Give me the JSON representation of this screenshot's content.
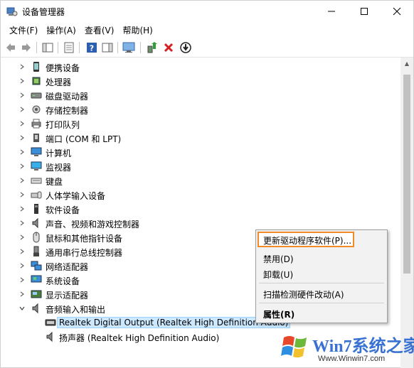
{
  "window": {
    "title": "设备管理器"
  },
  "menubar": {
    "items": [
      "文件(F)",
      "操作(A)",
      "查看(V)",
      "帮助(H)"
    ]
  },
  "toolbar": {
    "icons": [
      "back-arrow-icon",
      "forward-arrow-icon",
      "show-hide-tree-icon",
      "properties-icon",
      "help-icon",
      "action-pane-icon",
      "monitor-scan-icon",
      "update-driver-icon",
      "uninstall-x-icon",
      "download-driver-icon"
    ]
  },
  "tree": {
    "items": [
      {
        "label": "便携设备",
        "expanded": false,
        "icon": "portable-device-icon"
      },
      {
        "label": "处理器",
        "expanded": false,
        "icon": "processor-icon"
      },
      {
        "label": "磁盘驱动器",
        "expanded": false,
        "icon": "disk-drive-icon"
      },
      {
        "label": "存储控制器",
        "expanded": false,
        "icon": "storage-controller-icon"
      },
      {
        "label": "打印队列",
        "expanded": false,
        "icon": "printer-icon"
      },
      {
        "label": "端口 (COM 和 LPT)",
        "expanded": false,
        "icon": "port-icon"
      },
      {
        "label": "计算机",
        "expanded": false,
        "icon": "computer-icon"
      },
      {
        "label": "监视器",
        "expanded": false,
        "icon": "monitor-icon"
      },
      {
        "label": "键盘",
        "expanded": false,
        "icon": "keyboard-icon"
      },
      {
        "label": "人体学输入设备",
        "expanded": false,
        "icon": "hid-icon"
      },
      {
        "label": "软件设备",
        "expanded": false,
        "icon": "software-device-icon"
      },
      {
        "label": "声音、视频和游戏控制器",
        "expanded": false,
        "icon": "speaker-icon"
      },
      {
        "label": "鼠标和其他指针设备",
        "expanded": false,
        "icon": "mouse-icon"
      },
      {
        "label": "通用串行总线控制器",
        "expanded": false,
        "icon": "usb-icon"
      },
      {
        "label": "网络适配器",
        "expanded": false,
        "icon": "network-adapter-icon"
      },
      {
        "label": "系统设备",
        "expanded": false,
        "icon": "system-device-icon"
      },
      {
        "label": "显示适配器",
        "expanded": false,
        "icon": "display-adapter-icon"
      },
      {
        "label": "音频输入和输出",
        "expanded": true,
        "icon": "audio-icon"
      }
    ],
    "children": [
      {
        "label": "Realtek Digital Output (Realtek High Definition Audio)",
        "selected": true,
        "icon": "digital-output-icon"
      },
      {
        "label": "扬声器 (Realtek High Definition Audio)",
        "selected": false,
        "icon": "speaker-icon"
      }
    ]
  },
  "context_menu": {
    "items": [
      "更新驱动程序软件(P)...",
      "禁用(D)",
      "卸载(U)",
      "扫描检测硬件改动(A)",
      "属性(R)"
    ]
  },
  "watermark": {
    "brand": "Win7系统之家",
    "url": "Www.Winwin7.com"
  },
  "colors": {
    "highlight_border": "#f08c28",
    "selection_bg": "#cce8ff",
    "menu_bg": "#f2f2f2"
  }
}
